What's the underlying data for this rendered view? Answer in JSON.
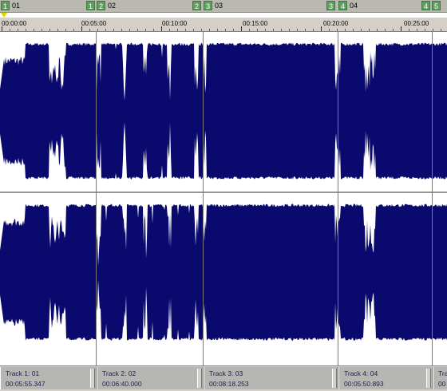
{
  "markers": [
    {
      "num": "1",
      "label": "01"
    },
    {
      "num": "1",
      "label": ""
    },
    {
      "num": "2",
      "label": "02"
    },
    {
      "num": "2",
      "label": ""
    },
    {
      "num": "3",
      "label": "03"
    },
    {
      "num": "3",
      "label": ""
    },
    {
      "num": "4",
      "label": "04"
    },
    {
      "num": "4",
      "label": ""
    },
    {
      "num": "5",
      "label": ""
    }
  ],
  "ruler_labels": [
    "00:00:00",
    "00:05:00",
    "00:10:00",
    "00:15:00",
    "00:20:00",
    "00:25:00"
  ],
  "tracks": [
    {
      "name": "Track 1: 01",
      "length": "00:05:55.347"
    },
    {
      "name": "Track 2: 02",
      "length": "00:06:40.000"
    },
    {
      "name": "Track 3: 03",
      "length": "00:08:18.253"
    },
    {
      "name": "Track 4: 04",
      "length": "00:05:50.893"
    },
    {
      "name": "Tra",
      "length": "00"
    }
  ],
  "colors": {
    "waveform": "#0a0a6e",
    "marker": "#5f9e5f"
  }
}
